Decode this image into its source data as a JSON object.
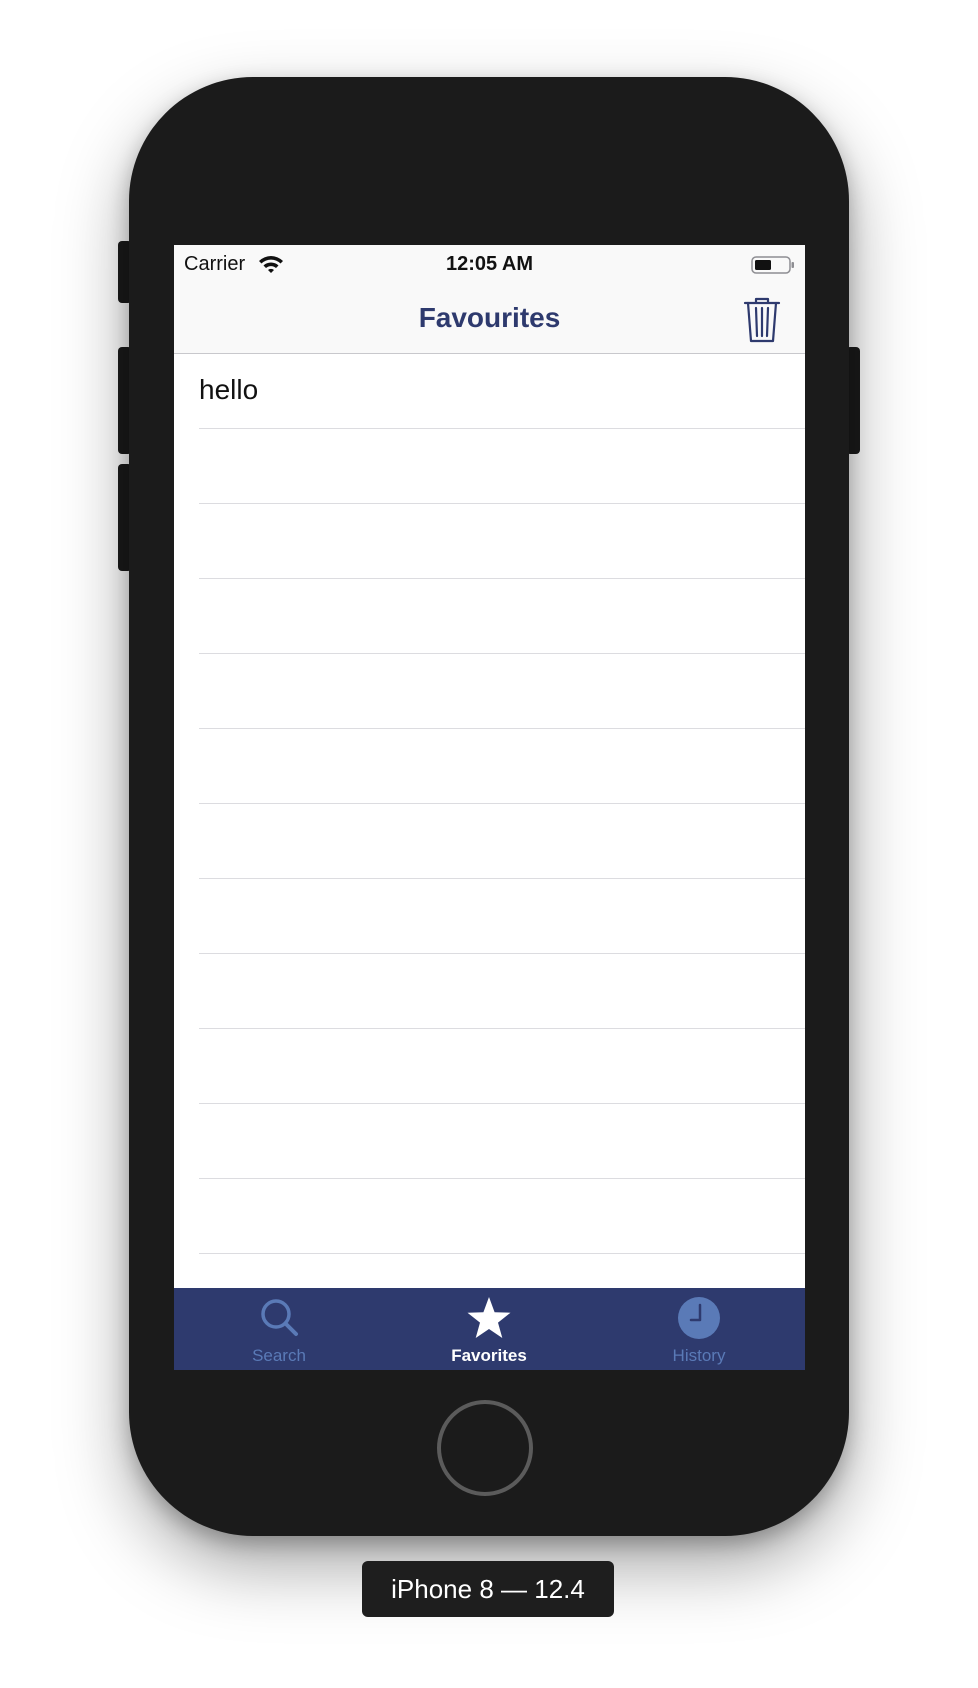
{
  "status_bar": {
    "carrier": "Carrier",
    "time": "12:05 AM"
  },
  "nav_bar": {
    "title": "Favourites",
    "trash_icon": "trash-icon"
  },
  "favorites": {
    "items": [
      "hello"
    ],
    "empty_rows": 11
  },
  "tab_bar": {
    "tabs": [
      {
        "label": "Search",
        "icon": "magnifier-icon",
        "active": false
      },
      {
        "label": "Favorites",
        "icon": "star-icon",
        "active": true
      },
      {
        "label": "History",
        "icon": "clock-icon",
        "active": false
      }
    ]
  },
  "device": {
    "label": "iPhone 8 — 12.4"
  },
  "colors": {
    "brand_navy": "#2e3a6e",
    "tab_inactive": "#5a7ab7",
    "tab_active": "#ffffff"
  }
}
